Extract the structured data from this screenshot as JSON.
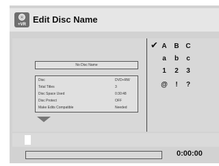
{
  "header": {
    "logo_text": "+VR",
    "title": "Edit Disc Name"
  },
  "disc_name_box": {
    "text": "No Disc Name"
  },
  "disc_info": [
    {
      "label": "Disc",
      "value": "DVD+RW"
    },
    {
      "label": "Total Titles",
      "value": "3"
    },
    {
      "label": "Disc Space Used",
      "value": "0:30:48"
    },
    {
      "label": "Disc Protect",
      "value": "OFF"
    },
    {
      "label": "Make Edits Compatible",
      "value": "Needed"
    }
  ],
  "character_palette": {
    "selected_marker": "✔",
    "rows": [
      [
        "A",
        "B",
        "C"
      ],
      [
        "a",
        "b",
        "c"
      ],
      [
        "1",
        "2",
        "3"
      ],
      [
        "@",
        "!",
        "?"
      ]
    ]
  },
  "footer": {
    "time": "0:00:00"
  }
}
